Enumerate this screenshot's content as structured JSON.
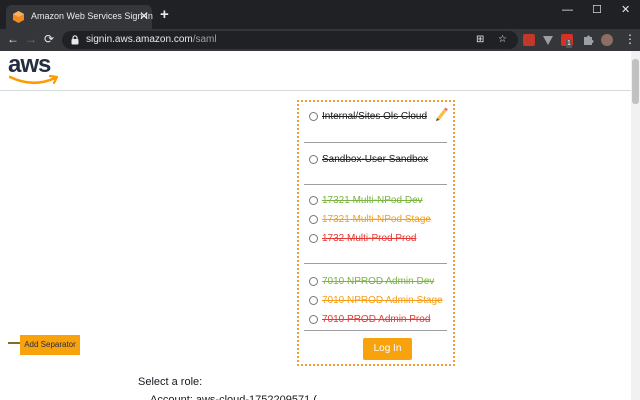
{
  "browser": {
    "tab": {
      "title": "Amazon Web Services Sign-In",
      "close": "✕"
    },
    "new_tab": "+",
    "window": {
      "minimize": "—",
      "maximize": "☐",
      "close": "✕"
    },
    "nav": {
      "back": "←",
      "forward": "→",
      "reload": "⟳"
    },
    "url": {
      "host": "signin.aws.amazon.com",
      "path": "/saml"
    },
    "omnibox_icons": {
      "translate": "⊞",
      "bookmark": "☆"
    },
    "extensions": [
      {
        "name": "ublock-icon",
        "color": "#c0392b"
      },
      {
        "name": "v-extension-icon",
        "color": "#9aa0a6"
      },
      {
        "name": "red-extension-icon",
        "color": "#d93025",
        "badge": "1"
      },
      {
        "name": "puzzle-icon",
        "color": "#9aa0a6"
      }
    ],
    "menu": "⋮"
  },
  "page": {
    "logo": "aws",
    "roles": [
      {
        "label": "Internal/Sites Ols Cloud",
        "color": "#202124"
      },
      {
        "label": "Sandbox-User Sandbox",
        "color": "#202124"
      },
      {
        "label": "17321 Multi-NPod Dev",
        "color": "#7cb342"
      },
      {
        "label": "17321 Multi-NPod Stage",
        "color": "#f59e1b"
      },
      {
        "label": "1732 Multi-Prod Prod",
        "color": "#e53935"
      },
      {
        "label": "7010 NPROD Admin Dev",
        "color": "#7cb342"
      },
      {
        "label": "7010 NPROD Admin Stage",
        "color": "#f59e1b"
      },
      {
        "label": "7010 PROD Admin Prod",
        "color": "#e53935"
      }
    ],
    "login_button": "Log In",
    "add_separator": "Add Separator",
    "select_role": "Select a role:",
    "partial_line": "Account: aws-cloud-1752209571 (..."
  },
  "colors": {
    "accent": "#f8a20e",
    "chrome_dark": "#202124",
    "chrome_mid": "#35363a"
  }
}
